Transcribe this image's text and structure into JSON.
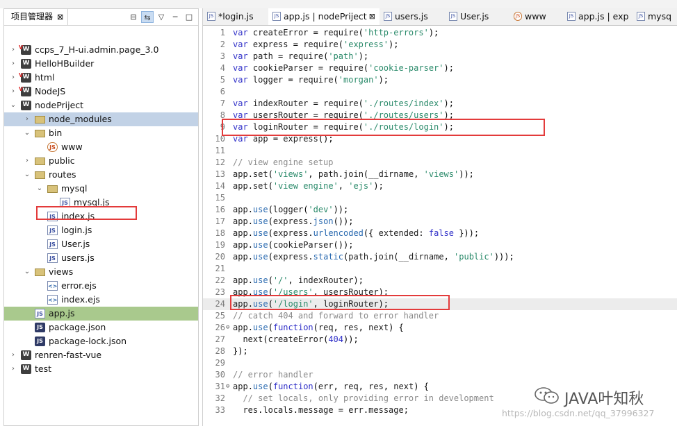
{
  "explorer": {
    "title": "项目管理器",
    "close_symbol": "⊠",
    "toolbar": {
      "collapse": "⊟",
      "link": "⇆",
      "menu": "▽",
      "minimize": "─",
      "maximize": "□"
    },
    "items": [
      {
        "label": "ccps_7_H-ui.admin.page_3.0",
        "arrow": "›",
        "icon": "project-v-icon"
      },
      {
        "label": "HelloHBuilder",
        "arrow": "›",
        "icon": "project-icon"
      },
      {
        "label": "html",
        "arrow": "›",
        "icon": "project-v-icon"
      },
      {
        "label": "NodeJS",
        "arrow": "›",
        "icon": "project-v-icon"
      },
      {
        "label": "nodePriject",
        "arrow": "⌄",
        "icon": "project-icon"
      },
      {
        "label": "node_modules",
        "arrow": "›",
        "icon": "folder-icon"
      },
      {
        "label": "bin",
        "arrow": "⌄",
        "icon": "folder-icon"
      },
      {
        "label": "www",
        "arrow": "",
        "icon": "js-file-icon"
      },
      {
        "label": "public",
        "arrow": "›",
        "icon": "folder-icon"
      },
      {
        "label": "routes",
        "arrow": "⌄",
        "icon": "folder-icon"
      },
      {
        "label": "mysql",
        "arrow": "⌄",
        "icon": "folder-icon"
      },
      {
        "label": "mysql.js",
        "arrow": "",
        "icon": "js-file-icon"
      },
      {
        "label": "index.js",
        "arrow": "",
        "icon": "js-file-icon"
      },
      {
        "label": "login.js",
        "arrow": "",
        "icon": "js-file-icon"
      },
      {
        "label": "User.js",
        "arrow": "",
        "icon": "js-file-icon"
      },
      {
        "label": "users.js",
        "arrow": "",
        "icon": "js-file-icon"
      },
      {
        "label": "views",
        "arrow": "⌄",
        "icon": "folder-icon"
      },
      {
        "label": "error.ejs",
        "arrow": "",
        "icon": "ejs-file-icon"
      },
      {
        "label": "index.ejs",
        "arrow": "",
        "icon": "ejs-file-icon"
      },
      {
        "label": "app.js",
        "arrow": "",
        "icon": "js-file-icon"
      },
      {
        "label": "package.json",
        "arrow": "",
        "icon": "json-file-icon"
      },
      {
        "label": "package-lock.json",
        "arrow": "",
        "icon": "json-file-icon"
      },
      {
        "label": "renren-fast-vue",
        "arrow": "›",
        "icon": "project-icon"
      },
      {
        "label": "test",
        "arrow": "›",
        "icon": "project-icon"
      }
    ]
  },
  "tabs": [
    {
      "label": "*login.js"
    },
    {
      "label": "app.js | nodePriject",
      "close": "⊠"
    },
    {
      "label": "users.js"
    },
    {
      "label": "User.js"
    },
    {
      "label": "www"
    },
    {
      "label": "app.js | exp"
    },
    {
      "label": "mysq"
    }
  ],
  "code": {
    "lines": [
      {
        "n": "1",
        "text": "var createError = require('http-errors');"
      },
      {
        "n": "2",
        "text": "var express = require('express');"
      },
      {
        "n": "3",
        "text": "var path = require('path');"
      },
      {
        "n": "4",
        "text": "var cookieParser = require('cookie-parser');"
      },
      {
        "n": "5",
        "text": "var logger = require('morgan');"
      },
      {
        "n": "6",
        "text": ""
      },
      {
        "n": "7",
        "text": "var indexRouter = require('./routes/index');"
      },
      {
        "n": "8",
        "text": "var usersRouter = require('./routes/users');"
      },
      {
        "n": "9",
        "text": "var loginRouter = require('./routes/login');"
      },
      {
        "n": "10",
        "text": "var app = express();"
      },
      {
        "n": "11",
        "text": ""
      },
      {
        "n": "12",
        "text": "// view engine setup"
      },
      {
        "n": "13",
        "text": "app.set('views', path.join(__dirname, 'views'));"
      },
      {
        "n": "14",
        "text": "app.set('view engine', 'ejs');"
      },
      {
        "n": "15",
        "text": ""
      },
      {
        "n": "16",
        "text": "app.use(logger('dev'));"
      },
      {
        "n": "17",
        "text": "app.use(express.json());"
      },
      {
        "n": "18",
        "text": "app.use(express.urlencoded({ extended: false }));"
      },
      {
        "n": "19",
        "text": "app.use(cookieParser());"
      },
      {
        "n": "20",
        "text": "app.use(express.static(path.join(__dirname, 'public')));"
      },
      {
        "n": "21",
        "text": ""
      },
      {
        "n": "22",
        "text": "app.use('/', indexRouter);"
      },
      {
        "n": "23",
        "text": "app.use('/users', usersRouter);"
      },
      {
        "n": "24",
        "text": "app.use('/login', loginRouter);"
      },
      {
        "n": "25",
        "text": "// catch 404 and forward to error handler"
      },
      {
        "n": "26",
        "text": "app.use(function(req, res, next) {"
      },
      {
        "n": "27",
        "text": "  next(createError(404));"
      },
      {
        "n": "28",
        "text": "});"
      },
      {
        "n": "29",
        "text": ""
      },
      {
        "n": "30",
        "text": "// error handler"
      },
      {
        "n": "31",
        "text": "app.use(function(err, req, res, next) {"
      },
      {
        "n": "32",
        "text": "  // set locals, only providing error in development"
      },
      {
        "n": "33",
        "text": "  res.locals.message = err.message;"
      }
    ]
  },
  "watermark": {
    "name": "JAVA叶知秋",
    "url": "https://blog.csdn.net/qq_37996327"
  }
}
